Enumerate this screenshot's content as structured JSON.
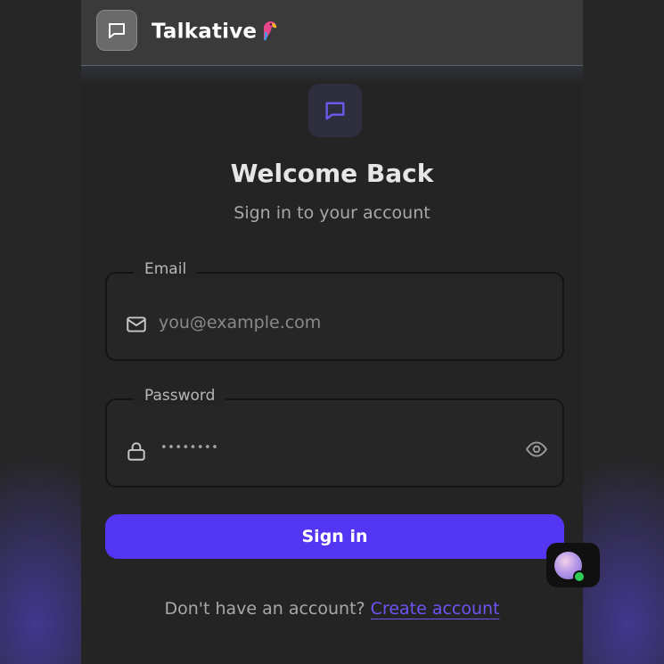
{
  "header": {
    "app_name": "Talkative",
    "logo_icon": "chat-bubble-icon",
    "emoji_icon": "parrot-emoji"
  },
  "hero": {
    "icon": "chat-bubble-icon",
    "title": "Welcome Back",
    "subtitle": "Sign in to your account"
  },
  "form": {
    "email": {
      "label": "Email",
      "placeholder": "you@example.com",
      "value": "",
      "icon": "mail-icon"
    },
    "password": {
      "label": "Password",
      "masked_value": "••••••••",
      "icon": "lock-icon",
      "toggle_icon": "eye-icon"
    },
    "submit_label": "Sign in"
  },
  "footer": {
    "prompt": "Don't have an account?",
    "link_label": "Create account"
  },
  "assistant": {
    "status": "online"
  },
  "colors": {
    "accent": "#5236f2",
    "link": "#6c55f5",
    "background": "#242424",
    "header": "#3a3a3a",
    "online": "#2ecc55"
  }
}
